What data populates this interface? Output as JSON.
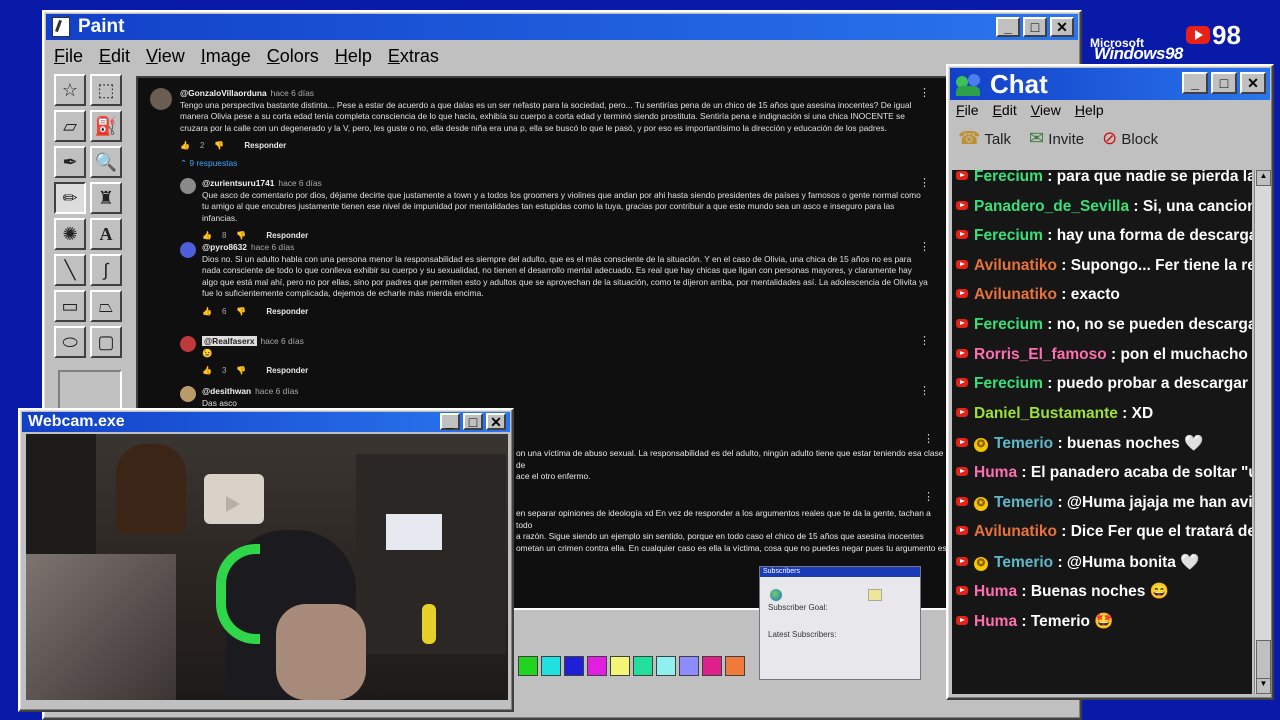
{
  "paint": {
    "title": "Paint",
    "menu": [
      "File",
      "Edit",
      "View",
      "Image",
      "Colors",
      "Help",
      "Extras"
    ]
  },
  "comments": [
    {
      "user": "@GonzaloVillaorduna",
      "ago": "hace 6 días",
      "text": "Tengo una perspectiva bastante distinta... Pese a estar de acuerdo a que dalas es un ser nefasto para la sociedad, pero... Tu sentirías pena de un chico de 15 años que asesina inocentes? De igual manera Olivia pese a su corta edad tenía completa consciencia de lo que hacía, exhibía su cuerpo a corta edad y terminó siendo prostituta. Sentiría pena e indignación si una chica INOCENTE se cruzara por la calle con un degenerado y la V, pero, les guste o no, ella desde niña era una p, ella se buscó lo que le pasó, y por eso es importantísimo la dirección y educación de los padres.",
      "likes": "2",
      "reply": "Responder"
    },
    {
      "user": "@zurientsuru1741",
      "ago": "hace 6 días",
      "text": "Que asco de comentario por dios, déjame decirte que justamente a town y a todos los groomers y violines que andan por ahi hasta siendo presidentes de países y famosos o gente normal como tu amigo al que encubres justamente tienen ese nivel de impunidad por mentalidades tan estupidas como la tuya, gracias por contribuir a que este mundo sea un asco  e inseguro para las infancias.",
      "likes": "8",
      "reply": "Responder"
    },
    {
      "user": "@pyro8632",
      "ago": "hace 6 días",
      "text": "Dios no. Si un adulto habla con una persona menor la responsabilidad es siempre del adulto, que es el más consciente de la situación. Y en el caso de Olivia, una chica de 15 años no es para nada consciente de todo lo que conlleva exhibir su cuerpo y su sexualidad, no tienen el desarrollo mental adecuado. Es real que hay chicas que ligan con personas mayores, y claramente hay algo que está mal ahí, pero no por ellas, sino por padres que permiten esto y adultos que se aprovechan de la situación, como te dijeron arriba, por mentalidades así. La adolescencia de Olivita ya fue lo suficientemente complicada, dejemos de echarle más mierda encima.",
      "likes": "6",
      "reply": "Responder"
    },
    {
      "user": "@Realfaserx",
      "ago": "hace 6 días",
      "text": "😉",
      "likes": "3",
      "reply": "Responder"
    },
    {
      "user": "@desithwan",
      "ago": "hace 6 días",
      "text": "Das asco",
      "likes": "",
      "reply": "Responder"
    }
  ],
  "replies_label": "9 respuestas",
  "partial_texts": [
    "on una víctima de abuso sexual. La responsabilidad es del adulto, ningún adulto tiene que estar teniendo esa clase de",
    "ace el otro enfermo.",
    "en separar opiniones de ideología xd En vez de responder a los argumentos reales que te da la gente, tachan a todo",
    "a razón. Sigue siendo un ejemplo sin sentido, porque en todo caso el chico de 15 años que asesina inocentes",
    "ometan un crimen contra ella. En cualquier caso es ella la víctima, cosa que no puedes negar pues tu argumento es"
  ],
  "subscribers": {
    "title": "Subscribers",
    "goal_label": "Subscriber Goal:",
    "latest_label": "Latest Subscribers:"
  },
  "webcam": {
    "title": "Webcam.exe"
  },
  "chat": {
    "title": "Chat",
    "menu": [
      "File",
      "Edit",
      "View",
      "Help"
    ],
    "toolbar": [
      "Talk",
      "Invite",
      "Block"
    ],
    "messages": [
      {
        "user": "Ferecium",
        "text": ": para que nadie se pierda las",
        "color": "#39e07a",
        "star": false
      },
      {
        "user": "Panadero_de_Sevilla",
        "text": ": Si, una cancion k le",
        "color": "#39e07a",
        "star": false
      },
      {
        "user": "Ferecium",
        "text": ": hay una forma de descargarlo u",
        "color": "#39e07a",
        "star": false
      },
      {
        "user": "Avilunatiko",
        "text": ": Supongo... Fer tiene la respue",
        "color": "#e8733a",
        "star": false
      },
      {
        "user": "Avilunatiko",
        "text": ": exacto",
        "color": "#e8733a",
        "star": false
      },
      {
        "user": "Ferecium",
        "text": ": no, no se pueden descargar, pe",
        "color": "#39e07a",
        "star": false
      },
      {
        "user": "Rorris_El_famoso",
        "text": ": pon el muchacho de lo",
        "color": "#ff6fb0",
        "star": false
      },
      {
        "user": "Ferecium",
        "text": ": puedo probar a descargar el sp",
        "color": "#39e07a",
        "star": false
      },
      {
        "user": "Daniel_Bustamante",
        "text": ": XD",
        "color": "#9de03a",
        "star": false
      },
      {
        "user": "Temerio",
        "text": ": buenas noches 🤍",
        "color": "#5fb8c8",
        "star": true
      },
      {
        "user": "Huma",
        "text": ": El panadero acaba de soltar \"una p",
        "color": "#ff6fb0",
        "star": false
      },
      {
        "user": "Temerio",
        "text": ": @Huma jajaja me han avisado",
        "color": "#5fb8c8",
        "star": true
      },
      {
        "user": "Avilunatiko",
        "text": ": Dice Fer que el tratará de des",
        "color": "#e8733a",
        "star": false
      },
      {
        "user": "Temerio",
        "text": ": @Huma bonita 🤍",
        "color": "#5fb8c8",
        "star": true
      },
      {
        "user": "Huma",
        "text": ": Buenas noches 😄",
        "color": "#ff6fb0",
        "star": false
      },
      {
        "user": "Huma",
        "text": ": Temerio 🤩",
        "color": "#ff6fb0",
        "star": false
      }
    ]
  },
  "logo": {
    "brand": "Microsoft",
    "product": "Windows98",
    "count": "98"
  },
  "palette": [
    "#21d41f",
    "#21e0e0",
    "#1f1fd8",
    "#e01fe0",
    "#f5f575",
    "#22e09a",
    "#8ff0f0",
    "#8c8cff",
    "#e0208a",
    "#ef7a3c"
  ]
}
